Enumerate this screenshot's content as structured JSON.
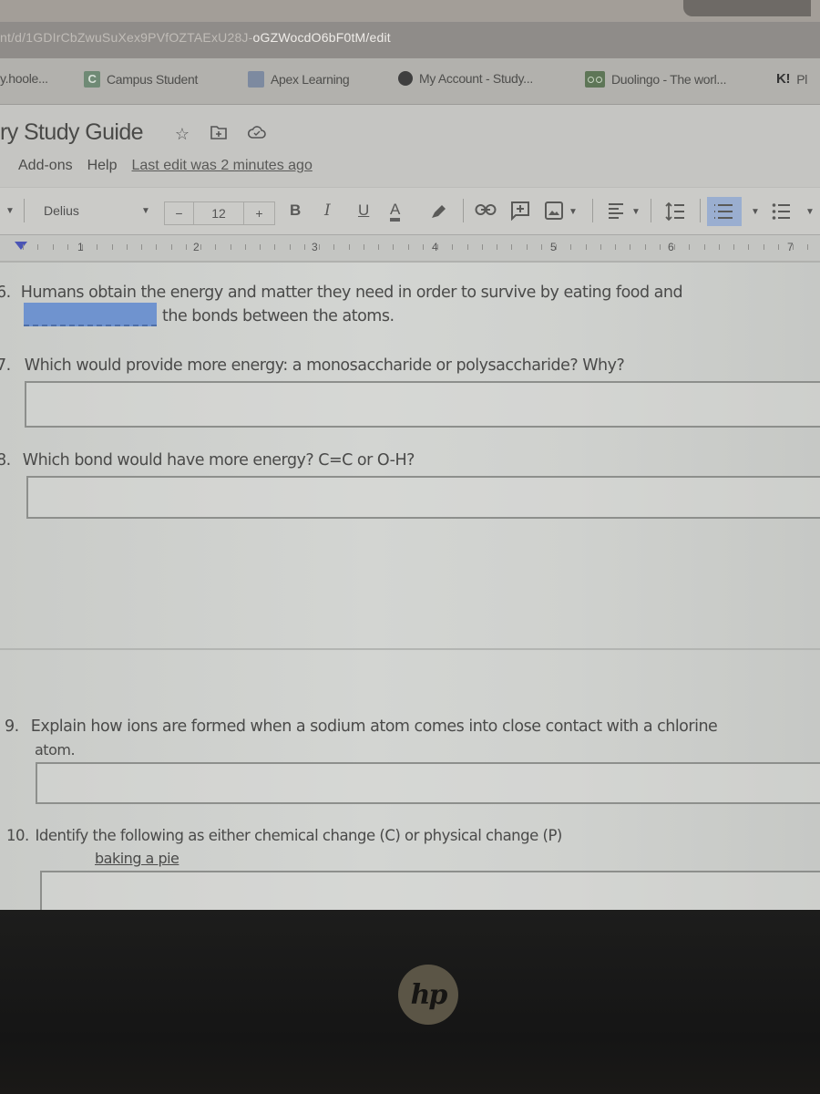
{
  "browser": {
    "url": "nt/d/1GDIrCbZwuSuXex9PVfOZTAExU28J-oGZWocdO6bF0tM/edit",
    "bookmarks": [
      {
        "label": "y.hoole...",
        "icon": "school-icon"
      },
      {
        "label": "Campus Student",
        "icon": "campus-icon"
      },
      {
        "label": "Apex Learning",
        "icon": "apex-icon"
      },
      {
        "label": "My Account - Study...",
        "icon": "study-icon"
      },
      {
        "label": "Duolingo - The worl...",
        "icon": "duolingo-icon"
      },
      {
        "label": "Pl",
        "icon": "kahoot-icon",
        "icon_text": "K!"
      }
    ]
  },
  "doc": {
    "title": "ry Study Guide",
    "menus": [
      "Add-ons",
      "Help"
    ],
    "last_edit": "Last edit was 2 minutes ago"
  },
  "toolbar": {
    "font": "Delius",
    "font_size": "12",
    "minus": "−",
    "plus": "+",
    "bold": "B",
    "italic": "I",
    "underline": "U",
    "text_color": "A"
  },
  "ruler": {
    "numbers": [
      "1",
      "2",
      "3",
      "4",
      "5",
      "6",
      "7"
    ]
  },
  "questions": [
    {
      "number": "6.",
      "text": "Humans obtain the energy and matter they need in order to survive by eating food and",
      "text2": "the bonds between the atoms."
    },
    {
      "number": "7.",
      "text": "Which would provide more energy: a monosaccharide or polysaccharide? Why?"
    },
    {
      "number": "8.",
      "text": "Which bond would have more energy? C=C  or O-H?"
    },
    {
      "number": "9.",
      "text": "Explain how ions are formed when a sodium atom comes into close contact with a chlorine",
      "text2": "atom."
    },
    {
      "number": "10.",
      "text": "Identify the following as either chemical change (C) or physical change (P)",
      "text2": "baking a pie"
    }
  ],
  "answers": [
    "",
    "",
    "",
    ""
  ],
  "colors": {
    "highlight_blue": "#6f93cf",
    "active_button": "#9aaed0"
  },
  "device": {
    "logo": "hp"
  }
}
